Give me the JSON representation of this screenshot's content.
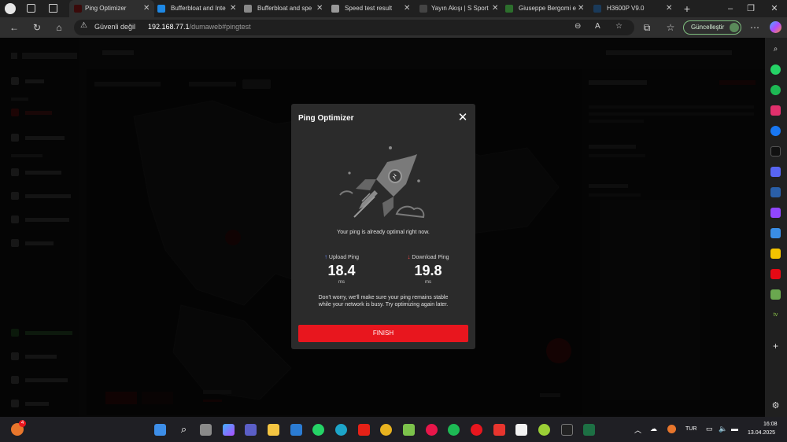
{
  "browser": {
    "tabs": [
      {
        "label": "Ping Optimizer",
        "active": true,
        "favicon": "netduma-icon"
      },
      {
        "label": "Bufferbloat and Inte",
        "active": false,
        "favicon": "w-icon"
      },
      {
        "label": "Bufferbloat and spe",
        "active": false,
        "favicon": "page-icon"
      },
      {
        "label": "Speed test result",
        "active": false,
        "favicon": "speedtest-icon"
      },
      {
        "label": "Yayın Akışı | S Sport",
        "active": false,
        "favicon": "ssport-icon"
      },
      {
        "label": "Giuseppe Bergomi e",
        "active": false,
        "favicon": "25-icon"
      },
      {
        "label": "H3600P V9.0",
        "active": false,
        "favicon": "router-icon"
      }
    ],
    "new_tab": "+",
    "address": {
      "security_label": "Güvenli değil",
      "url_host": "192.168.77.1",
      "url_path": "/dumaweb#pingtest"
    },
    "update_button": "Güncelleştir"
  },
  "modal": {
    "title": "Ping Optimizer",
    "status": "Your ping is already optimal right now.",
    "upload": {
      "label": "Upload Ping",
      "value": "18.4",
      "unit": "ms",
      "arrow": "↑"
    },
    "download": {
      "label": "Download Ping",
      "value": "19.8",
      "unit": "ms",
      "arrow": "↓"
    },
    "note": "Don't worry, we'll make sure your ping remains stable while your network is busy. Try optimizing again later.",
    "finish_label": "FINISH"
  },
  "taskbar": {
    "language": "TUR",
    "time": "16:08",
    "date": "13.04.2025",
    "notification_badge": "4"
  },
  "colors": {
    "accent_red": "#e8161e",
    "upload_arrow": "#6d8cff",
    "download_arrow": "#ff4d4d"
  }
}
